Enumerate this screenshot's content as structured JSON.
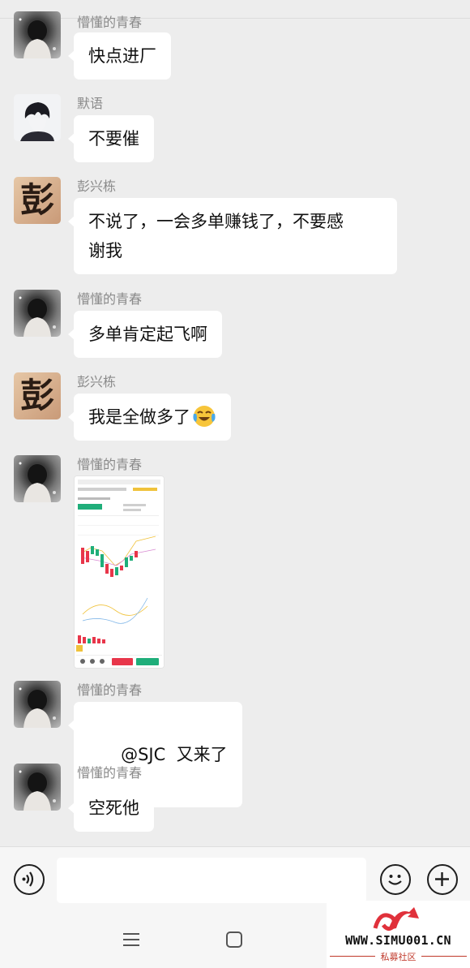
{
  "messages": [
    {
      "sender": "懵懂的青春",
      "text": "快点进厂"
    },
    {
      "sender": "默语",
      "text": "不要催"
    },
    {
      "sender": "彭兴栋",
      "text_line1": "不说了，一会多单赚钱了，不要感",
      "text_line2": "谢我"
    },
    {
      "sender": "懵懂的青春",
      "text": "多单肯定起飞啊"
    },
    {
      "sender": "彭兴栋",
      "text": "我是全做多了"
    },
    {
      "sender": "懵懂的青春",
      "image": "trading-app-screenshot"
    },
    {
      "sender": "懵懂的青春",
      "text": "@SJC  又来了"
    },
    {
      "sender": "懵懂的青春",
      "text": "空死他"
    }
  ],
  "avatars": {
    "peng_char": "彭"
  },
  "icons": {
    "voice": "voice-icon",
    "emoji": "emoji-icon",
    "plus": "plus-icon",
    "laugh_emoji": "laughing-crying-emoji",
    "menu": "menu-icon",
    "home": "home-square-icon"
  },
  "watermark": {
    "url": "WWW.SIMU001.CN",
    "sub": "私募社区"
  },
  "colors": {
    "chat_bg": "#ededed",
    "bubble_bg": "#ffffff",
    "sender_text": "#8a8a8a",
    "watermark_red": "#e0313b"
  }
}
